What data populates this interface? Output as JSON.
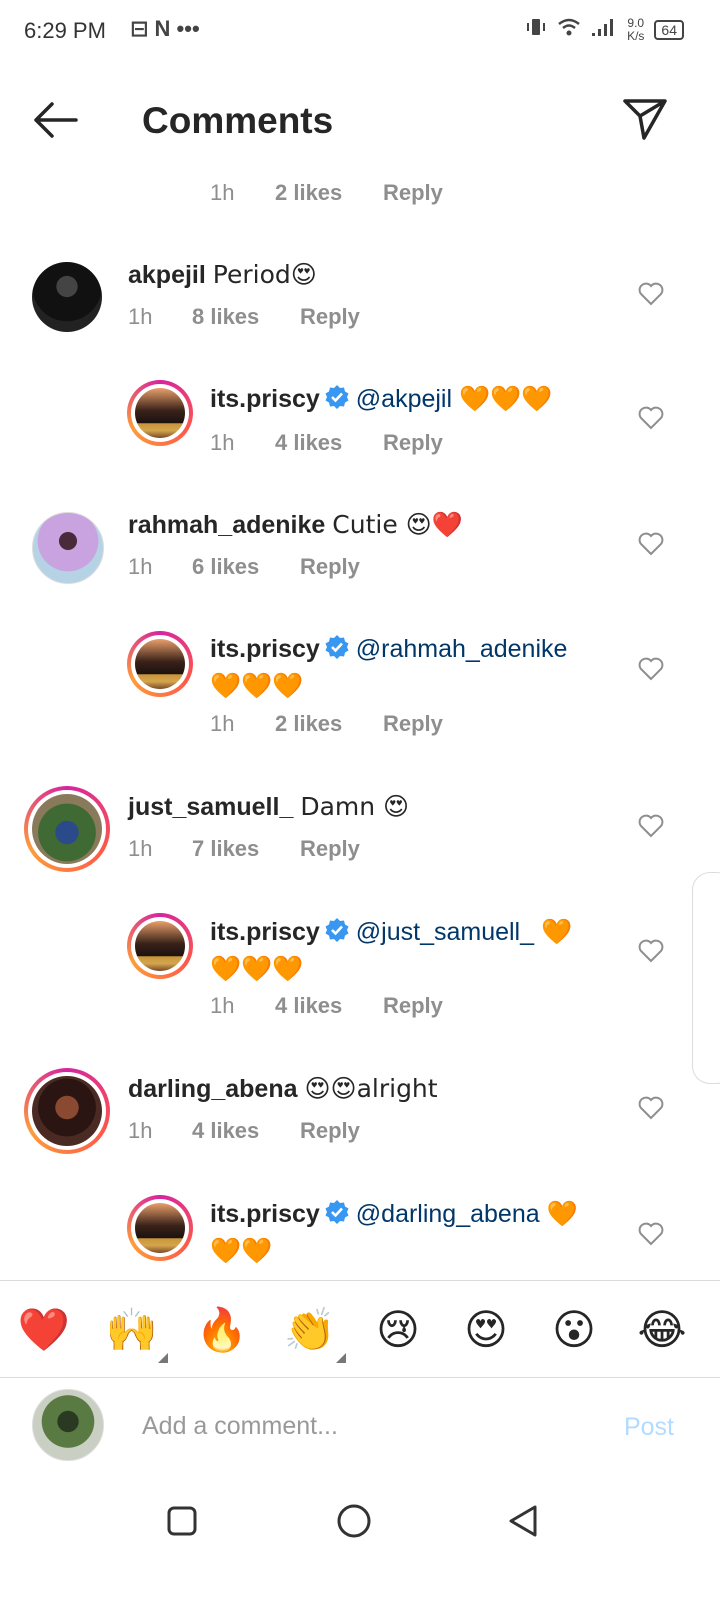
{
  "status_bar": {
    "time": "6:29 PM",
    "notif_icons": "⊟ N •••",
    "speed_top": "9.0",
    "speed_bottom": "K/s",
    "battery": "64"
  },
  "header": {
    "title": "Comments"
  },
  "top_meta": {
    "time": "1h",
    "likes": "2 likes",
    "reply": "Reply"
  },
  "comments": [
    {
      "user": "akpejil",
      "text": "Period😍",
      "time": "1h",
      "likes": "8 likes",
      "reply": "Reply"
    },
    {
      "user": "its.priscy",
      "mention": "@akpejil",
      "text": "🧡🧡🧡",
      "time": "1h",
      "likes": "4 likes",
      "reply": "Reply"
    },
    {
      "user": "rahmah_adenike",
      "text": "Cutie 😍❤️",
      "time": "1h",
      "likes": "6 likes",
      "reply": "Reply"
    },
    {
      "user": "its.priscy",
      "mention": "@rahmah_adenike",
      "text": "🧡🧡🧡",
      "time": "1h",
      "likes": "2 likes",
      "reply": "Reply"
    },
    {
      "user": "just_samuell_",
      "text": "Damn 😍",
      "time": "1h",
      "likes": "7 likes",
      "reply": "Reply"
    },
    {
      "user": "its.priscy",
      "mention": "@just_samuell_",
      "text": "🧡",
      "text2": "🧡🧡🧡",
      "time": "1h",
      "likes": "4 likes",
      "reply": "Reply"
    },
    {
      "user": "darling_abena",
      "text": "😍😍alright",
      "time": "1h",
      "likes": "4 likes",
      "reply": "Reply"
    },
    {
      "user": "its.priscy",
      "mention": "@darling_abena",
      "text": "🧡",
      "text2": "🧡🧡"
    }
  ],
  "emoji_bar": [
    "❤️",
    "🙌",
    "🔥",
    "👏",
    "😢",
    "😍",
    "😮",
    "😂"
  ],
  "composer": {
    "placeholder": "Add a comment...",
    "post": "Post"
  },
  "colors": {
    "mention": "#00376b",
    "verified": "#3897f0",
    "meta_gray": "#8e8e8e",
    "post_disabled": "#b3dbff",
    "story_ring": "#d6249f"
  }
}
